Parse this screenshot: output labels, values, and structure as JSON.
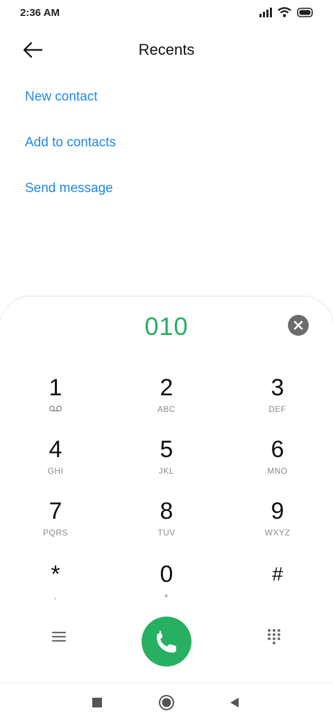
{
  "status_bar": {
    "time": "2:36 AM",
    "icons": [
      "signal-icon",
      "wifi-icon",
      "battery-icon"
    ]
  },
  "header": {
    "back_icon": "arrow-left-icon",
    "title": "Recents"
  },
  "actions": {
    "new_contact": "New contact",
    "add_to_contacts": "Add to contacts",
    "send_message": "Send message"
  },
  "dialer": {
    "number": "010",
    "clear_icon": "clear-icon",
    "keys": [
      {
        "digit": "1",
        "letters": "",
        "icon": "voicemail-icon"
      },
      {
        "digit": "2",
        "letters": "ABC"
      },
      {
        "digit": "3",
        "letters": "DEF"
      },
      {
        "digit": "4",
        "letters": "GHI"
      },
      {
        "digit": "5",
        "letters": "JKL"
      },
      {
        "digit": "6",
        "letters": "MNO"
      },
      {
        "digit": "7",
        "letters": "PQRS"
      },
      {
        "digit": "8",
        "letters": "TUV"
      },
      {
        "digit": "9",
        "letters": "WXYZ"
      },
      {
        "digit": "*",
        "letters": ","
      },
      {
        "digit": "0",
        "letters": "+"
      },
      {
        "digit": "#",
        "letters": ""
      }
    ],
    "bottom_icons": [
      "menu-icon",
      "phone-call-icon",
      "dialpad-icon"
    ]
  },
  "navigation": {
    "icons": [
      "recents-square-icon",
      "home-circle-icon",
      "back-triangle-icon"
    ]
  },
  "colors": {
    "accent_link": "#1e88e5",
    "number_green": "#27ae60",
    "call_green": "#27b062"
  }
}
